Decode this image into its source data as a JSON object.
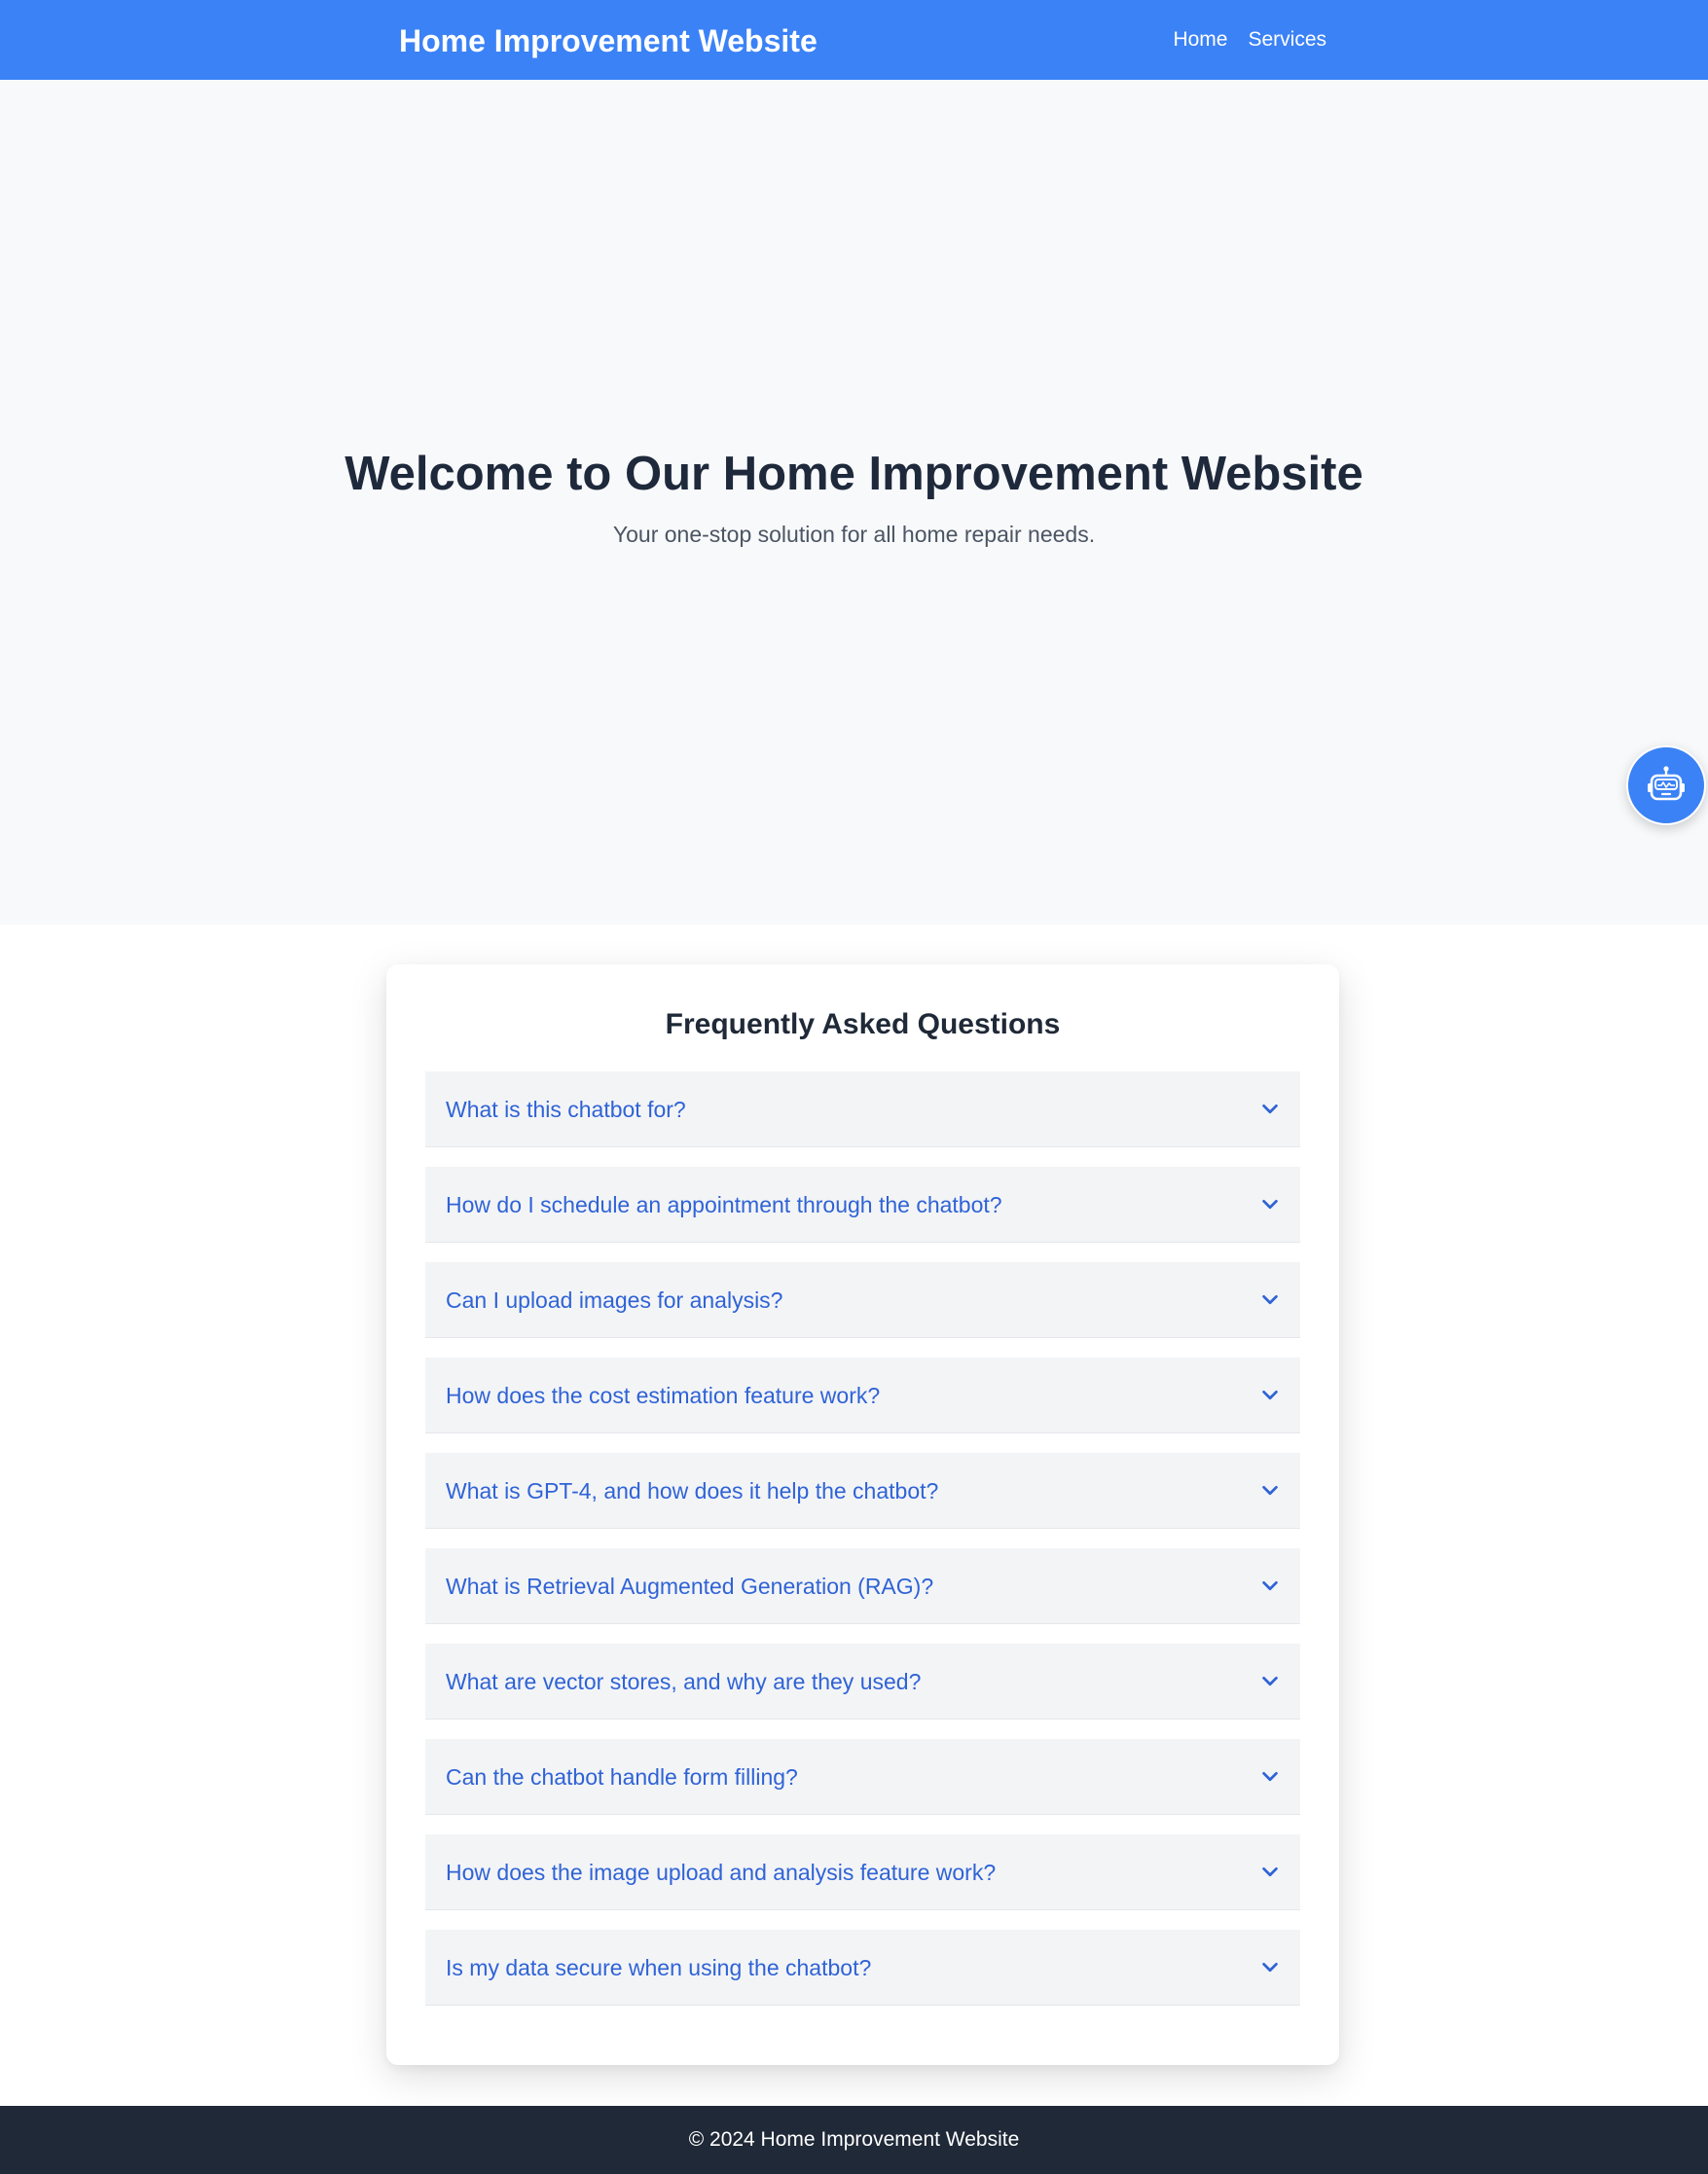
{
  "header": {
    "brand": "Home Improvement Website",
    "nav": [
      {
        "label": "Home"
      },
      {
        "label": "Services"
      }
    ]
  },
  "hero": {
    "title": "Welcome to Our Home Improvement Website",
    "subtitle": "Your one-stop solution for all home repair needs."
  },
  "chatbot": {
    "icon": "robot-icon",
    "accent": "#3b82f6"
  },
  "faq": {
    "title": "Frequently Asked Questions",
    "items": [
      {
        "question": "What is this chatbot for?"
      },
      {
        "question": "How do I schedule an appointment through the chatbot?"
      },
      {
        "question": "Can I upload images for analysis?"
      },
      {
        "question": "How does the cost estimation feature work?"
      },
      {
        "question": "What is GPT-4, and how does it help the chatbot?"
      },
      {
        "question": "What is Retrieval Augmented Generation (RAG)?"
      },
      {
        "question": "What are vector stores, and why are they used?"
      },
      {
        "question": "Can the chatbot handle form filling?"
      },
      {
        "question": "How does the image upload and analysis feature work?"
      },
      {
        "question": "Is my data secure when using the chatbot?"
      }
    ]
  },
  "footer": {
    "text": "© 2024 Home Improvement Website"
  },
  "colors": {
    "primary": "#3b82f6",
    "question_text": "#2f63d6",
    "footer_bg": "#1f2937",
    "hero_bg": "#f8f9fb"
  }
}
